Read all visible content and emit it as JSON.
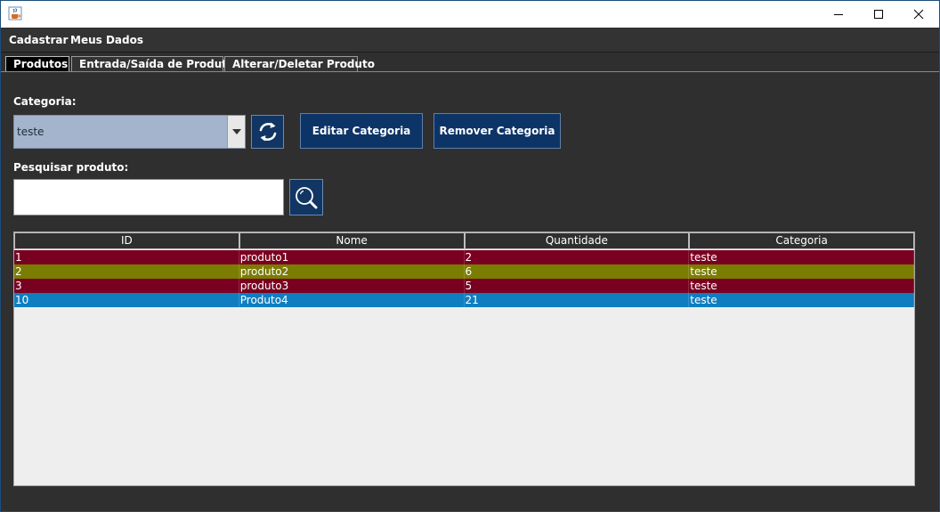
{
  "window": {
    "icon": "java-cup-icon",
    "controls": [
      "minimize-icon",
      "maximize-icon",
      "close-icon"
    ]
  },
  "menu": {
    "items": [
      "Cadastrar",
      "Meus Dados"
    ]
  },
  "tabs": [
    {
      "label": "Produtos",
      "active": true
    },
    {
      "label": "Entrada/Saída de Produtos",
      "active": false
    },
    {
      "label": "Alterar/Deletar Produto",
      "active": false
    }
  ],
  "category": {
    "label": "Categoria:",
    "selected": "teste",
    "refresh_icon": "refresh-icon",
    "edit_label": "Editar Categoria",
    "remove_label": "Remover Categoria"
  },
  "search": {
    "label": "Pesquisar produto:",
    "value": "",
    "search_icon": "magnifier-icon"
  },
  "table": {
    "columns": [
      "ID",
      "Nome",
      "Quantidade",
      "Categoria"
    ],
    "rows": [
      {
        "id": "1",
        "nome": "produto1",
        "quantidade": "2",
        "categoria": "teste",
        "color": "#7a0021"
      },
      {
        "id": "2",
        "nome": "produto2",
        "quantidade": "6",
        "categoria": "teste",
        "color": "#7a7d00"
      },
      {
        "id": "3",
        "nome": "produto3",
        "quantidade": "5",
        "categoria": "teste",
        "color": "#7a0021"
      },
      {
        "id": "10",
        "nome": "Produto4",
        "quantidade": "21",
        "categoria": "teste",
        "color": "#0f7ec1"
      }
    ]
  },
  "colors": {
    "background": "#2f2f2f",
    "button": "#0d3466",
    "combo": "#a3b4cc",
    "table_empty": "#eeeeee"
  }
}
